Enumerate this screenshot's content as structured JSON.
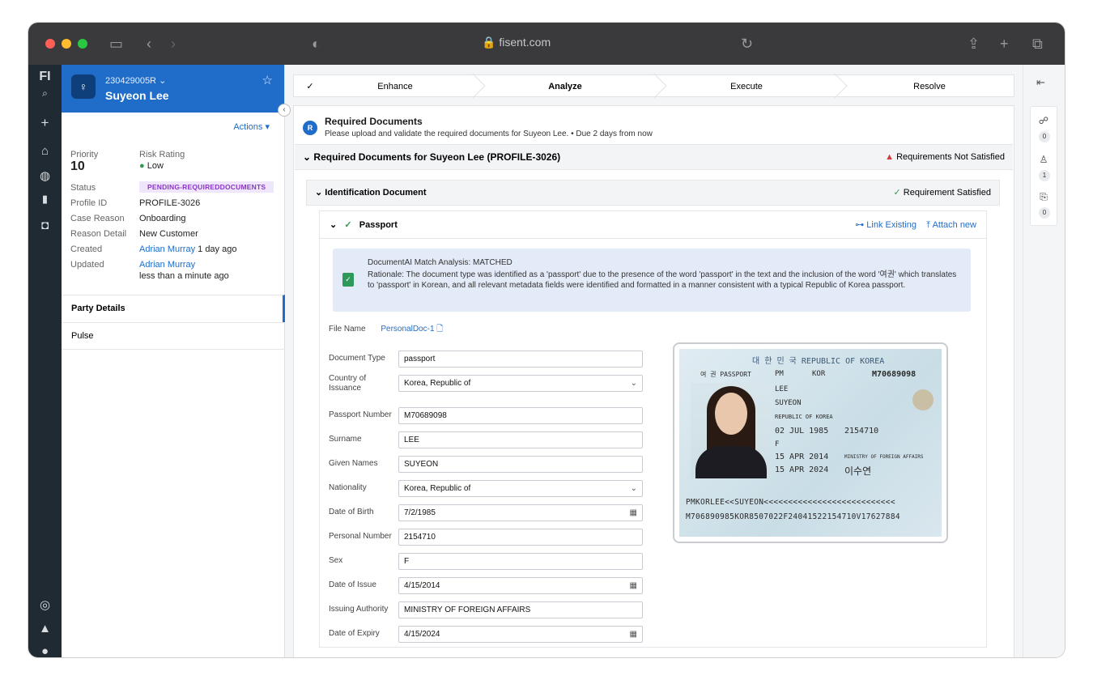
{
  "browser": {
    "url": "fisent.com"
  },
  "nav": {
    "logo": "FI"
  },
  "profile": {
    "id": "230429005R",
    "name": "Suyeon Lee",
    "actions_label": "Actions",
    "priority_label": "Priority",
    "priority_value": "10",
    "risk_label": "Risk Rating",
    "risk_value": "Low",
    "status_label": "Status",
    "status_value": "PENDING-REQUIREDDOCUMENTS",
    "profile_id_label": "Profile ID",
    "profile_id_value": "PROFILE-3026",
    "case_reason_label": "Case Reason",
    "case_reason_value": "Onboarding",
    "reason_detail_label": "Reason Detail",
    "reason_detail_value": "New Customer",
    "created_label": "Created",
    "created_by": "Adrian Murray",
    "created_when": "1 day ago",
    "updated_label": "Updated",
    "updated_by": "Adrian Murray",
    "updated_when": "less than a minute ago",
    "tabs": [
      "Party Details",
      "Pulse"
    ]
  },
  "steps": [
    "Enhance",
    "Analyze",
    "Execute",
    "Resolve"
  ],
  "task": {
    "avatar": "R",
    "title": "Required Documents",
    "subtitle": "Please upload and validate the required documents for Suyeon Lee. • Due 2 days from now"
  },
  "section": {
    "title": "Required Documents for Suyeon Lee (PROFILE-3026)",
    "status": "Requirements Not Satisfied"
  },
  "id_section": {
    "title": "Identification Document",
    "status": "Requirement Satisfied"
  },
  "document": {
    "name": "Passport",
    "link_existing": "Link Existing",
    "attach_new": "Attach new",
    "ai_heading": "DocumentAI Match Analysis: MATCHED",
    "ai_body": "Rationale: The document type was identified as a 'passport' due to the presence of the word 'passport' in the text and the inclusion of the word '여권' which translates to 'passport' in Korean, and all relevant metadata fields were identified and formatted in a manner consistent with a typical Republic of Korea passport.",
    "file_name_label": "File Name",
    "file_name": "PersonalDoc-1",
    "fields": [
      {
        "label": "Document Type",
        "value": "passport"
      },
      {
        "label": "Country of Issuance",
        "value": "Korea, Republic of"
      },
      {
        "label": "Passport Number",
        "value": "M70689098"
      },
      {
        "label": "Surname",
        "value": "LEE"
      },
      {
        "label": "Given Names",
        "value": "SUYEON"
      },
      {
        "label": "Nationality",
        "value": "Korea, Republic of"
      },
      {
        "label": "Date of Birth",
        "value": "7/2/1985"
      },
      {
        "label": "Personal Number",
        "value": "2154710"
      },
      {
        "label": "Sex",
        "value": "F"
      },
      {
        "label": "Date of Issue",
        "value": "4/15/2014"
      },
      {
        "label": "Issuing Authority",
        "value": "MINISTRY OF FOREIGN AFFAIRS"
      },
      {
        "label": "Date of Expiry",
        "value": "4/15/2024"
      }
    ]
  },
  "passport_image": {
    "header": "대 한 민 국   REPUBLIC OF KOREA",
    "type_label": "여 권  PASSPORT",
    "type": "PM",
    "country": "KOR",
    "number": "M70689098",
    "surname": "LEE",
    "given": "SUYEON",
    "nationality": "REPUBLIC OF KOREA",
    "dob": "02 JUL 1985",
    "personal_no": "2154710",
    "sex": "F",
    "issue": "15 APR 2014",
    "authority": "MINISTRY OF FOREIGN AFFAIRS",
    "expiry": "15 APR 2024",
    "signature": "이수연",
    "mrz1": "PMKORLEE<<SUYEON<<<<<<<<<<<<<<<<<<<<<<<<<<<",
    "mrz2": "M706890985KOR8507022F24041522154710V17627884"
  },
  "rail": {
    "counts": [
      "0",
      "1",
      "0"
    ]
  }
}
